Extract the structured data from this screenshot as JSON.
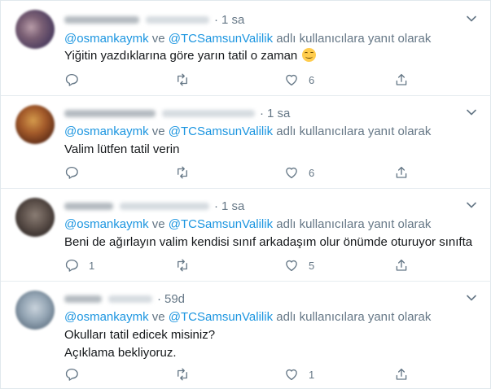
{
  "tweets": [
    {
      "time": "1 sa",
      "reply_users": [
        "@osmankaymk",
        "@TCSamsunValilik"
      ],
      "reply_connector": "ve",
      "reply_suffix": "adlı kullanıcılara yanıt olarak",
      "text_lines": [
        "Yiğitin yazdıklarına göre yarın tatil o zaman"
      ],
      "emoji": "smiling-face-with-smiling-eyes",
      "reply_count": "",
      "retweet_count": "",
      "like_count": "6",
      "avatar_colors": [
        "#4a3b5e",
        "#b89ca8"
      ]
    },
    {
      "time": "1 sa",
      "reply_users": [
        "@osmankaymk",
        "@TCSamsunValilik"
      ],
      "reply_connector": "ve",
      "reply_suffix": "adlı kullanıcılara yanıt olarak",
      "text_lines": [
        "Valim lütfen tatil verin"
      ],
      "reply_count": "",
      "retweet_count": "",
      "like_count": "6",
      "avatar_colors": [
        "#7a3a1c",
        "#d49a4c"
      ]
    },
    {
      "time": "1 sa",
      "reply_users": [
        "@osmankaymk",
        "@TCSamsunValilik"
      ],
      "reply_connector": "ve",
      "reply_suffix": "adlı kullanıcılara yanıt olarak",
      "text_lines": [
        "Beni de ağırlayın valim kendisi sınıf arkadaşım olur önümde oturuyor sınıfta"
      ],
      "reply_count": "1",
      "retweet_count": "",
      "like_count": "5",
      "avatar_colors": [
        "#3c3431",
        "#8a7d74"
      ]
    },
    {
      "time": "59d",
      "reply_users": [
        "@osmankaymk",
        "@TCSamsunValilik"
      ],
      "reply_connector": "ve",
      "reply_suffix": "adlı kullanıcılara yanıt olarak",
      "text_lines": [
        "Okulları tatil edicek misiniz?",
        "Açıklama bekliyoruz."
      ],
      "reply_count": "",
      "retweet_count": "",
      "like_count": "1",
      "avatar_colors": [
        "#6f8294",
        "#c9d3dc"
      ]
    }
  ],
  "colors": {
    "link": "#1b95e0",
    "secondary_text": "#657786",
    "primary_text": "#14171a",
    "divider": "#e6ecf0"
  },
  "icons": {
    "reply": "reply-icon",
    "retweet": "retweet-icon",
    "like": "like-icon",
    "share": "share-icon",
    "more": "chevron-down-icon"
  }
}
